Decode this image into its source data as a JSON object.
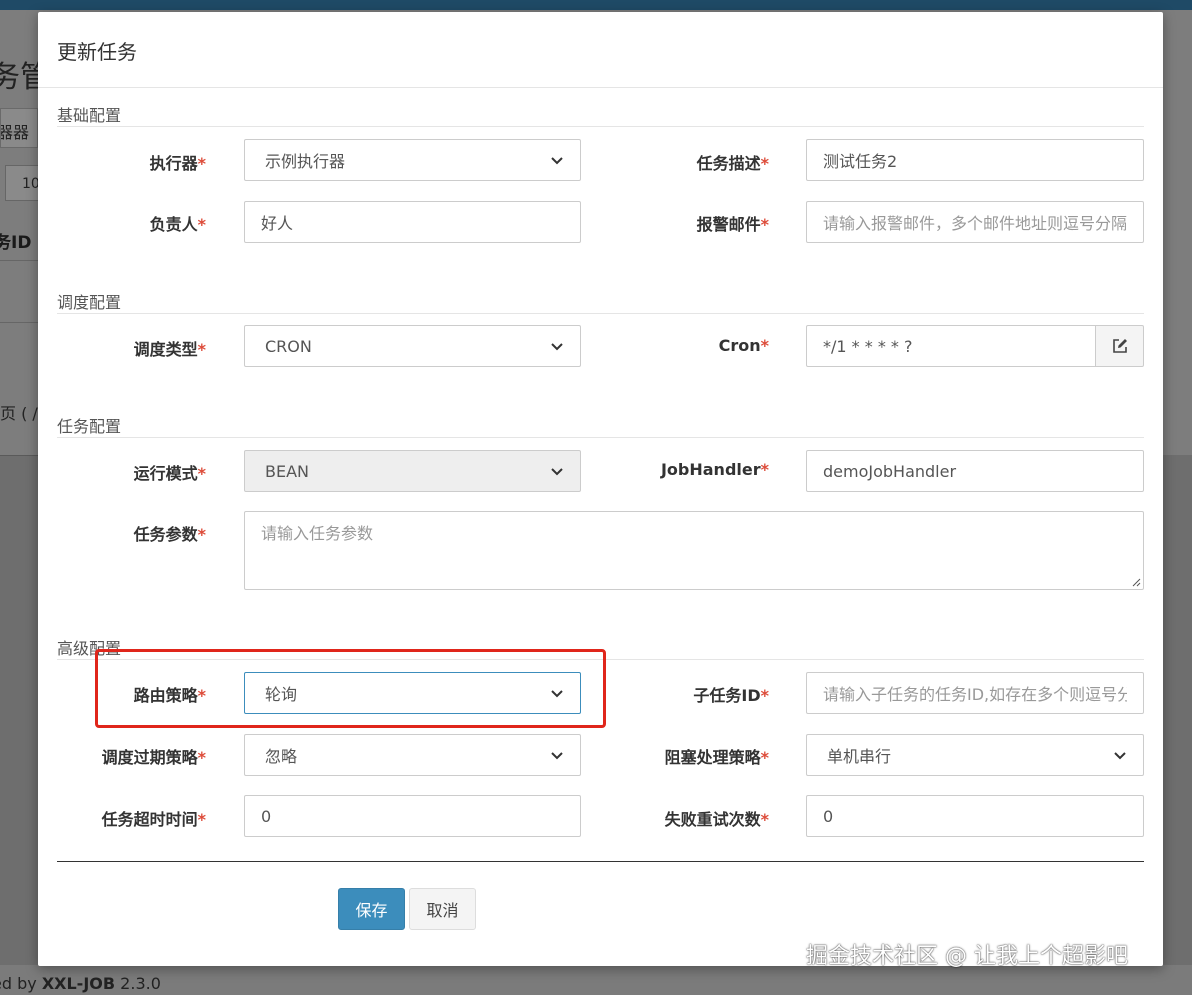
{
  "background": {
    "page_title_fragment": "务管",
    "tab_fragment": "器器",
    "page_size_fragment": "10",
    "column_header_fragment": "务ID",
    "pagination_fragment": "页 ( /",
    "footer_prefix": "ed by",
    "footer_brand": "XXL-JOB",
    "footer_version": "2.3.0"
  },
  "modal": {
    "title": "更新任务",
    "sections": {
      "basic": "基础配置",
      "schedule": "调度配置",
      "task": "任务配置",
      "advanced": "高级配置"
    },
    "fields": {
      "executor": {
        "label": "执行器",
        "value": "示例执行器"
      },
      "job_desc": {
        "label": "任务描述",
        "value": "测试任务2"
      },
      "author": {
        "label": "负责人",
        "value": "好人"
      },
      "alarm_email": {
        "label": "报警邮件",
        "placeholder": "请输入报警邮件，多个邮件地址则逗号分隔"
      },
      "schedule_type": {
        "label": "调度类型",
        "value": "CRON"
      },
      "cron": {
        "label": "Cron",
        "value": "*/1 * * * * ?"
      },
      "glue_type": {
        "label": "运行模式",
        "value": "BEAN"
      },
      "job_handler": {
        "label": "JobHandler",
        "value": "demoJobHandler"
      },
      "job_param": {
        "label": "任务参数",
        "placeholder": "请输入任务参数"
      },
      "route_strategy": {
        "label": "路由策略",
        "value": "轮询"
      },
      "child_job_id": {
        "label": "子任务ID",
        "placeholder": "请输入子任务的任务ID,如存在多个则逗号分隔"
      },
      "misfire_strategy": {
        "label": "调度过期策略",
        "value": "忽略"
      },
      "block_strategy": {
        "label": "阻塞处理策略",
        "value": "单机串行"
      },
      "timeout": {
        "label": "任务超时时间",
        "value": "0"
      },
      "fail_retry": {
        "label": "失败重试次数",
        "value": "0"
      }
    },
    "required_mark": "*",
    "buttons": {
      "save": "保存",
      "cancel": "取消"
    }
  },
  "watermark": "掘金技术社区 @ 让我上个超影吧",
  "colors": {
    "primary": "#3c8dbc",
    "required": "#dd4b39",
    "highlight_box": "#e0261b",
    "top_bar": "#1f4a66"
  },
  "icons": [
    "chevron-down-icon",
    "edit-icon",
    "resize-grip-icon"
  ]
}
